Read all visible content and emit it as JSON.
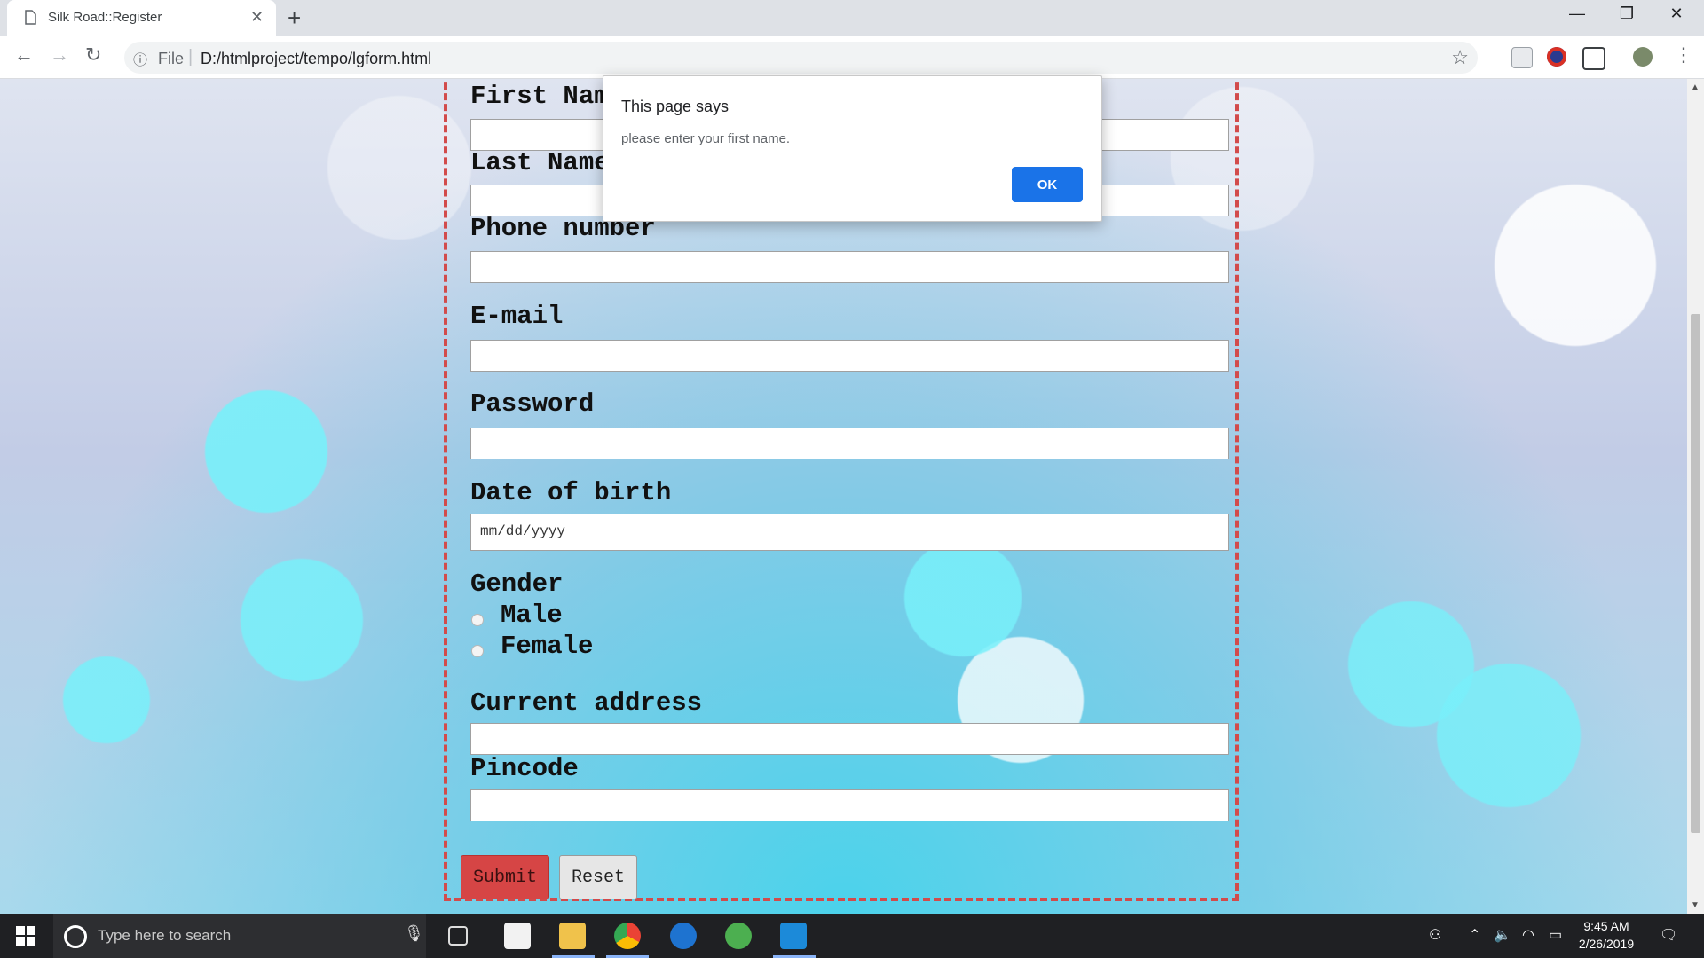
{
  "browser": {
    "tab_title": "Silk Road::Register",
    "tab_close": "✕",
    "new_tab": "+",
    "url_scheme": "File",
    "url_separator": "|",
    "url": "D:/htmlproject/tempo/lgform.html",
    "window_controls": {
      "minimize": "—",
      "restore": "❐",
      "close": "✕"
    }
  },
  "form": {
    "fields": [
      {
        "label": "First Name",
        "type": "text",
        "value": ""
      },
      {
        "label": "Last Name",
        "type": "text",
        "value": ""
      },
      {
        "label": "Phone number",
        "type": "text",
        "value": ""
      },
      {
        "label": "E-mail",
        "type": "text",
        "value": ""
      },
      {
        "label": "Password",
        "type": "password",
        "value": ""
      },
      {
        "label": "Date of birth",
        "type": "date",
        "placeholder": "mm/dd/yyyy"
      },
      {
        "label": "Current address",
        "type": "text",
        "value": ""
      },
      {
        "label": "Pincode",
        "type": "text",
        "value": ""
      }
    ],
    "gender": {
      "label": "Gender",
      "options": [
        "Male",
        "Female"
      ],
      "selected": null
    },
    "submit_label": "Submit",
    "reset_label": "Reset",
    "border_color": "#d24b4b"
  },
  "dialog": {
    "title": "This page says",
    "message": "please enter your first name.",
    "ok_label": "OK",
    "accent": "#1a73e8"
  },
  "taskbar": {
    "search_placeholder": "Type here to search",
    "time": "9:45 AM",
    "date": "2/26/2019",
    "pinned_icons": [
      "task-view-icon",
      "store-icon",
      "file-explorer-icon",
      "chrome-icon",
      "edge-icon",
      "atom-icon",
      "wps-icon"
    ]
  }
}
